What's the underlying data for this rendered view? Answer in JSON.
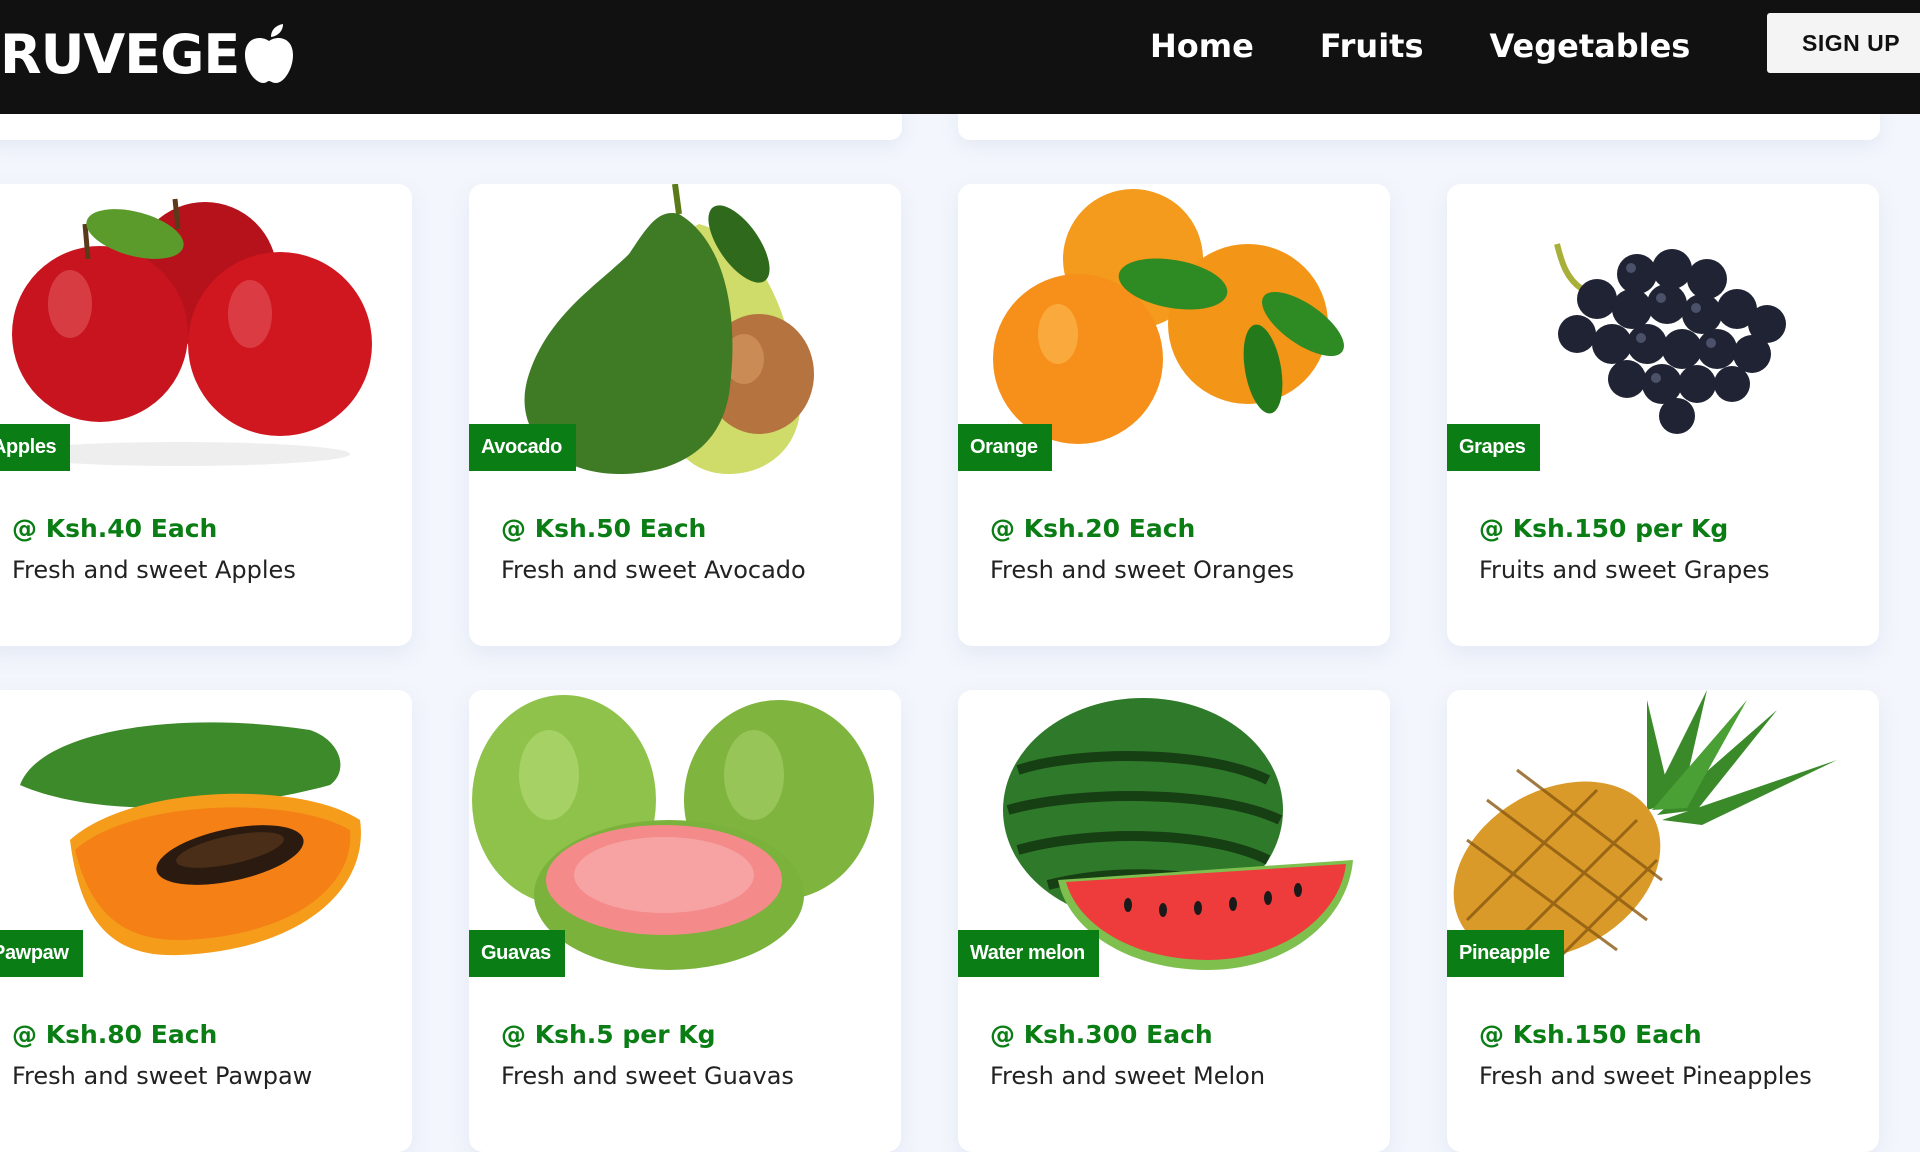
{
  "header": {
    "logo_text": "RUVEGE",
    "nav": [
      "Home",
      "Fruits",
      "Vegetables"
    ],
    "signup_label": "SIGN UP"
  },
  "products": [
    {
      "tag": "Apples",
      "price": "@ Ksh.40 Each",
      "desc": "Fresh and sweet Apples",
      "icon": "apples-image"
    },
    {
      "tag": "Avocado",
      "price": "@ Ksh.50 Each",
      "desc": "Fresh and sweet Avocado",
      "icon": "avocado-image"
    },
    {
      "tag": "Orange",
      "price": "@ Ksh.20 Each",
      "desc": "Fresh and sweet Oranges",
      "icon": "orange-image"
    },
    {
      "tag": "Grapes",
      "price": "@ Ksh.150 per Kg",
      "desc": "Fruits and sweet Grapes",
      "icon": "grapes-image"
    },
    {
      "tag": "Pawpaw",
      "price": "@ Ksh.80 Each",
      "desc": "Fresh and sweet Pawpaw",
      "icon": "pawpaw-image"
    },
    {
      "tag": "Guavas",
      "price": "@ Ksh.5 per Kg",
      "desc": "Fresh and sweet Guavas",
      "icon": "guavas-image"
    },
    {
      "tag": "Water melon",
      "price": "@ Ksh.300 Each",
      "desc": "Fresh and sweet Melon",
      "icon": "watermelon-image"
    },
    {
      "tag": "Pineapple",
      "price": "@ Ksh.150 Each",
      "desc": "Fresh and sweet Pineapples",
      "icon": "pineapple-image"
    }
  ],
  "colors": {
    "accent": "#0a7d14",
    "header_bg": "#111111",
    "page_bg": "#f3f6fc"
  }
}
